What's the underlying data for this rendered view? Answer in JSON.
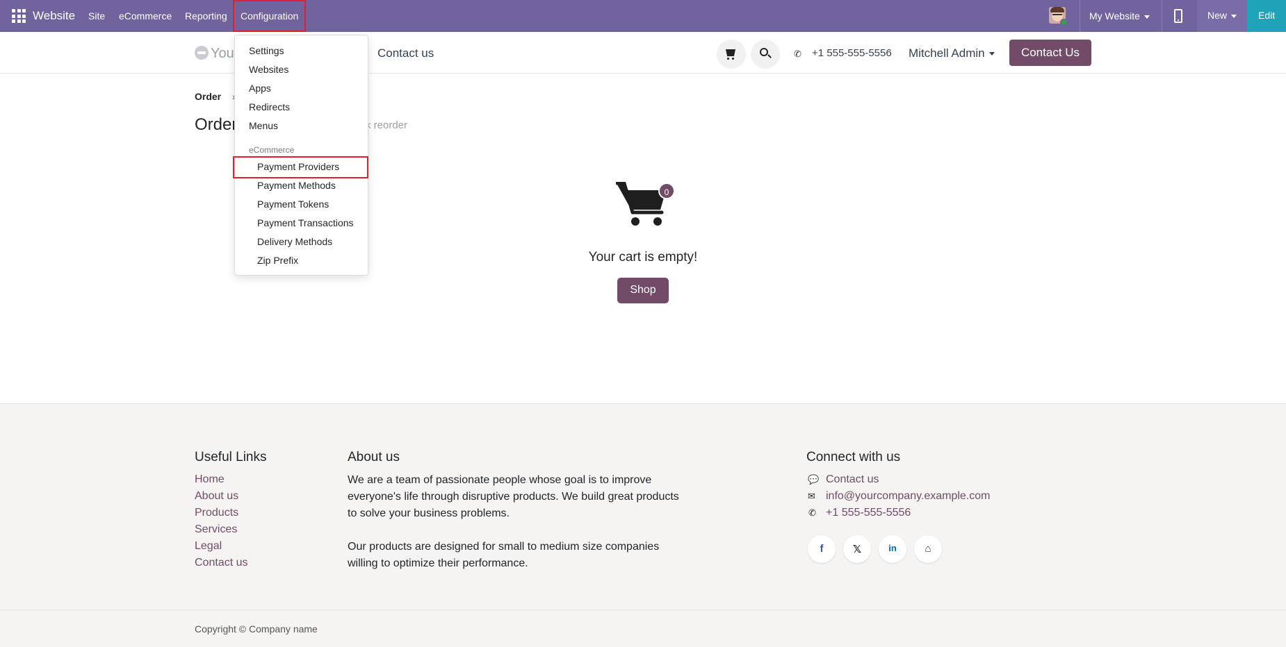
{
  "topbar": {
    "brand": "Website",
    "menus": [
      "Site",
      "eCommerce",
      "Reporting",
      "Configuration"
    ],
    "my_website": "My Website",
    "new_label": "New",
    "edit_label": "Edit",
    "accent_color": "#71639e"
  },
  "header": {
    "logo_text": "You",
    "nav_contact": "Contact us",
    "phone": "+1 555-555-5556",
    "user": "Mitchell Admin",
    "contact_button": "Contact Us"
  },
  "page": {
    "breadcrumb": "Order",
    "title": "Order",
    "reorder_hint": "k reorder",
    "cart_count": "0",
    "empty_message": "Your cart is empty!",
    "shop_button": "Shop"
  },
  "dropdown": {
    "items": [
      "Settings",
      "Websites",
      "Apps",
      "Redirects",
      "Menus"
    ],
    "section_header": "eCommerce",
    "section_items": [
      "Payment Providers",
      "Payment Methods",
      "Payment Tokens",
      "Payment Transactions",
      "Delivery Methods",
      "Zip Prefix"
    ]
  },
  "footer": {
    "useful_links_title": "Useful Links",
    "useful_links": [
      "Home",
      "About us",
      "Products",
      "Services",
      "Legal",
      "Contact us"
    ],
    "about_title": "About us",
    "about_lines_1": [
      "We are a team of passionate people whose goal is to improve",
      "everyone's life through disruptive products. We build great products",
      "to solve your business problems."
    ],
    "about_lines_2": [
      "Our products are designed for small to medium size companies",
      "willing to optimize their performance."
    ],
    "connect_title": "Connect with us",
    "connect_links": [
      "Contact us",
      "info@yourcompany.example.com",
      "+1 555-555-5556"
    ],
    "social_icons": [
      "facebook-icon",
      "x-icon",
      "linkedin-icon",
      "home-icon"
    ],
    "copyright": "Copyright © Company name"
  }
}
